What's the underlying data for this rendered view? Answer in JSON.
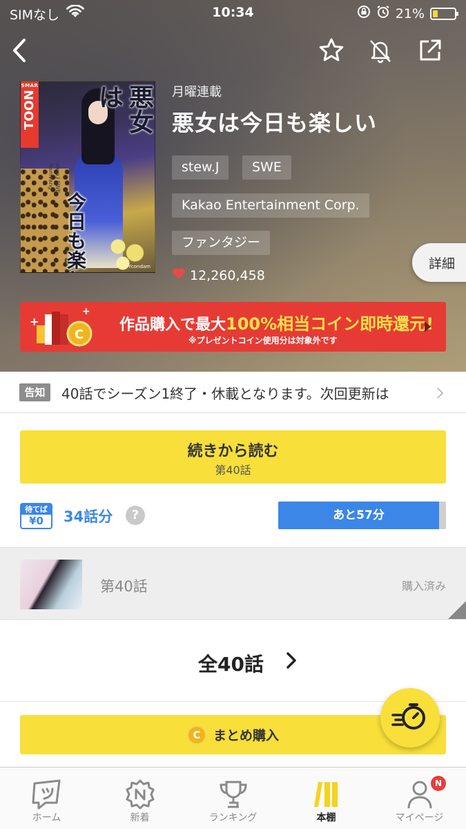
{
  "status_bar": {
    "carrier": "SIMなし",
    "time": "10:34",
    "battery": "21%"
  },
  "nav": {
    "back_icon": "chevron-left-icon",
    "favorite_icon": "star-icon",
    "notification_icon": "bell-off-icon",
    "share_icon": "share-icon"
  },
  "work": {
    "schedule": "月曜連載",
    "title": "悪女は今日も楽しい",
    "authors": [
      "stew.J",
      "SWE"
    ],
    "publisher": "Kakao Entertainment Corp.",
    "genre": "ファンタジー",
    "likes": "12,260,458",
    "detail_label": "詳細",
    "cover": {
      "logo_top": "SMAR",
      "logo_main": "TOON",
      "title_top": "悪女は",
      "title_bottom": "今日も楽しい",
      "credits": "stew.J SWE Namvang",
      "publisher_mark": "Ycondam"
    }
  },
  "promo": {
    "text_prefix": "作品購入で最大",
    "text_highlight": "100%相当コイン即時還元!",
    "note": "※プレゼントコイン使用分は対象外です"
  },
  "notice": {
    "badge": "告知",
    "text": "40話でシーズン1終了・休載となります。次回更新は"
  },
  "continue": {
    "label": "続きから読む",
    "episode": "第40話"
  },
  "wait_free": {
    "badge_top": "待てば",
    "badge_bottom": "¥0",
    "count": "34話分",
    "help": "?",
    "remaining": "あと57分",
    "progress": 0.96
  },
  "episode": {
    "title": "第40話",
    "status": "購入済み"
  },
  "all_episodes": {
    "label": "全40話"
  },
  "bulk": {
    "coin": "C",
    "label": "まとめ購入"
  },
  "tabbar": {
    "items": [
      {
        "label": "ホーム",
        "icon": "home-icon"
      },
      {
        "label": "新着",
        "icon": "new-icon"
      },
      {
        "label": "ランキング",
        "icon": "trophy-icon"
      },
      {
        "label": "本棚",
        "icon": "bookshelf-icon"
      },
      {
        "label": "マイページ",
        "icon": "user-icon"
      }
    ],
    "active": 3,
    "mypage_badge": "N"
  },
  "colors": {
    "accent_yellow": "#f8df3a",
    "wait_blue": "#3b86e6",
    "promo_red": "#e63b35",
    "like_red": "#e64a4a"
  }
}
